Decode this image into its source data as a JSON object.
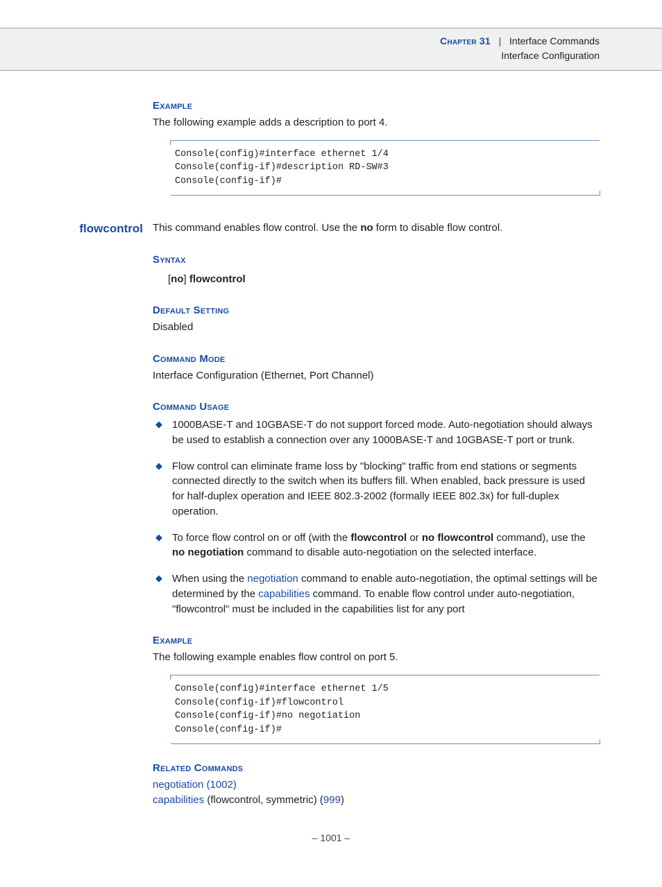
{
  "header": {
    "chapter_label": "Chapter 31",
    "section": "Interface Commands",
    "subsection": "Interface Configuration"
  },
  "ex1": {
    "heading": "Example",
    "text": "The following example adds a description to port 4.",
    "code": "Console(config)#interface ethernet 1/4\nConsole(config-if)#description RD-SW#3\nConsole(config-if)#"
  },
  "command": {
    "name": "flowcontrol",
    "intro_a": "This command enables flow control. Use the ",
    "intro_bold": "no",
    "intro_b": " form to disable flow control."
  },
  "syntax": {
    "heading": "Syntax",
    "lb": "[",
    "no": "no",
    "rb": "] ",
    "cmd": "flowcontrol"
  },
  "default": {
    "heading": "Default Setting",
    "value": "Disabled"
  },
  "mode": {
    "heading": "Command Mode",
    "value": "Interface Configuration (Ethernet, Port Channel)"
  },
  "usage": {
    "heading": "Command Usage",
    "b1": "1000BASE-T and 10GBASE-T do not support forced mode. Auto-negotiation should always be used to establish a connection over any 1000BASE-T and 10GBASE-T port or trunk.",
    "b2": "Flow control can eliminate frame loss by \"blocking\" traffic from end stations or segments connected directly to the switch when its buffers fill. When enabled, back pressure is used for half-duplex operation and IEEE 802.3-2002 (formally IEEE 802.3x) for full-duplex operation.",
    "b3_a": "To force flow control on or off (with the ",
    "b3_bold1": "flowcontrol",
    "b3_b": " or ",
    "b3_bold2": "no flowcontrol",
    "b3_c": " command), use the ",
    "b3_bold3": "no negotiation",
    "b3_d": " command to disable auto-negotiation on the selected interface.",
    "b4_a": "When using the ",
    "b4_link1": "negotiation",
    "b4_b": " command to enable auto-negotiation, the optimal settings will be determined by the ",
    "b4_link2": "capabilities",
    "b4_c": " command. To enable flow control under auto-negotiation, \"flowcontrol\" must be included in the capabilities list for any port"
  },
  "ex2": {
    "heading": "Example",
    "text": "The following example enables flow control on port 5.",
    "code": "Console(config)#interface ethernet 1/5\nConsole(config-if)#flowcontrol\nConsole(config-if)#no negotiation\nConsole(config-if)#"
  },
  "related": {
    "heading": "Related Commands",
    "l1_link": "negotiation (1002)",
    "l2_link": "capabilities",
    "l2_text": " (flowcontrol, symmetric) (",
    "l2_page": "999",
    "l2_close": ")"
  },
  "footer": "–  1001  –"
}
